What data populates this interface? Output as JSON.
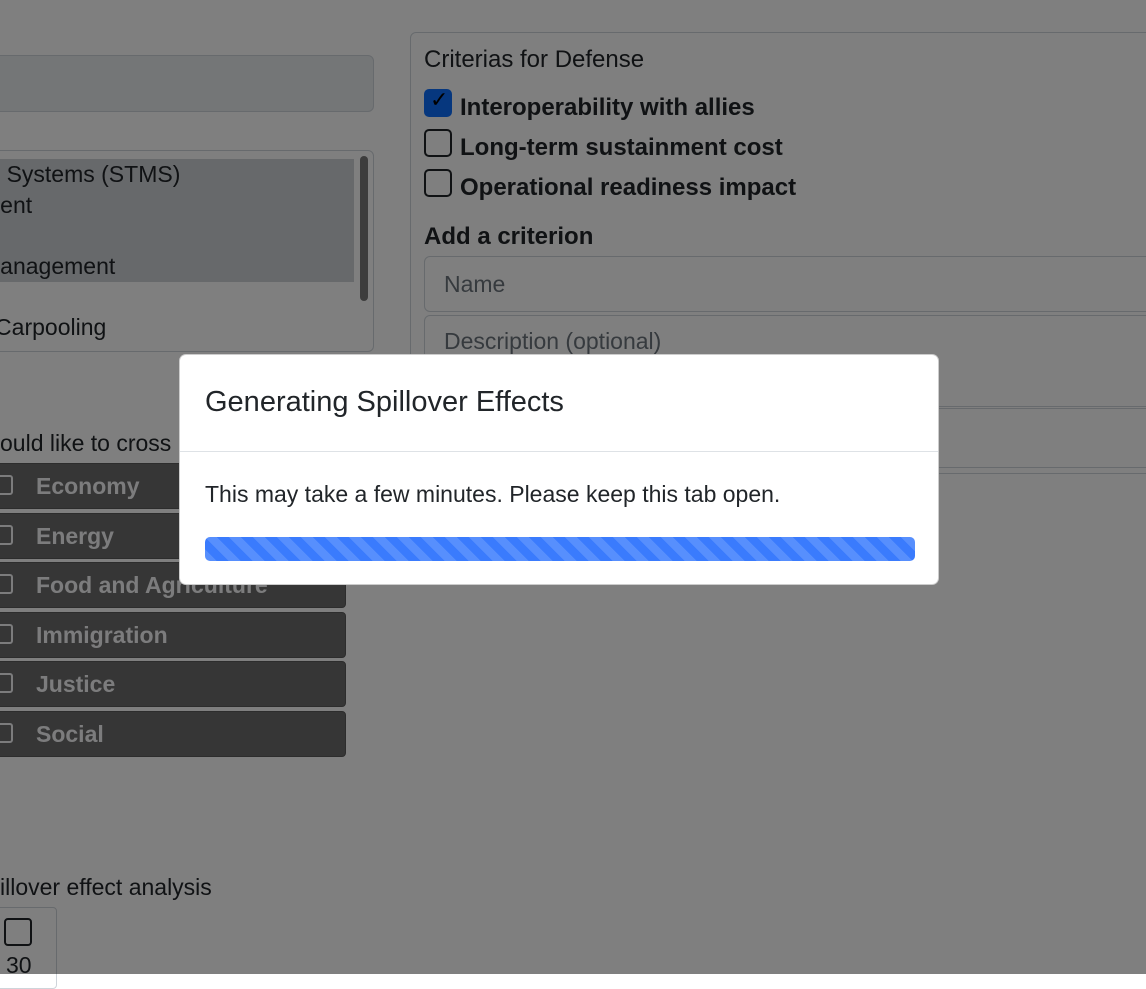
{
  "background": {
    "options_list": [
      {
        "label": "nt Systems (STMS)",
        "selected": true
      },
      {
        "label": "ment",
        "selected": true
      },
      {
        "label": "",
        "selected": true
      },
      {
        "label": "Management",
        "selected": true
      },
      {
        "label": "",
        "selected": false
      },
      {
        "label": "r Carpooling",
        "selected": false
      }
    ],
    "cross_label": "ould like to cross",
    "departments": [
      {
        "label": "Economy",
        "checked": false
      },
      {
        "label": "Energy",
        "checked": false
      },
      {
        "label": "Food and Agriculture",
        "checked": false
      },
      {
        "label": "Immigration",
        "checked": false
      },
      {
        "label": "Justice",
        "checked": false
      },
      {
        "label": "Social",
        "checked": false
      }
    ],
    "analysis_label": "illover effect analysis",
    "analysis_number": "30",
    "criteria_title": "Criterias for Defense",
    "criteria": [
      {
        "label": "Interoperability with allies",
        "checked": true
      },
      {
        "label": "Long-term sustainment cost",
        "checked": false
      },
      {
        "label": "Operational readiness impact",
        "checked": false
      }
    ],
    "add_criterion_title": "Add a criterion",
    "name_placeholder": "Name",
    "description_placeholder": "Description (optional)"
  },
  "modal": {
    "title": "Generating Spillover Effects",
    "message": "This may take a few minutes. Please keep this tab open.",
    "progress_percent": 100,
    "progress_color": "#3a7bfd"
  }
}
